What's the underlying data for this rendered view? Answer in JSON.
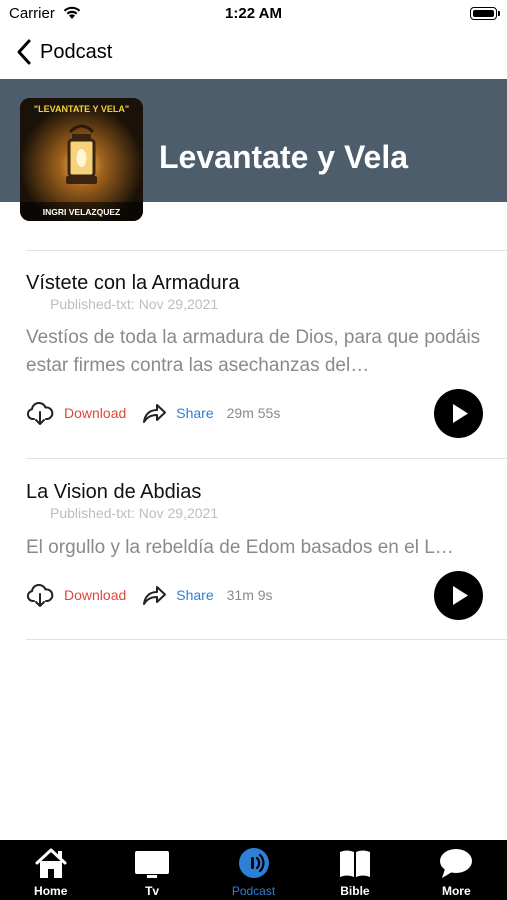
{
  "status_bar": {
    "carrier": "Carrier",
    "time": "1:22 AM",
    "icons": [
      "wifi-icon",
      "battery-icon"
    ]
  },
  "nav": {
    "back_label": "Podcast",
    "back_icon": "chevron-left-icon"
  },
  "podcast": {
    "title": "Levantate y Vela",
    "cover": {
      "title_text": "\"LEVANTATE Y VELA\"",
      "author_text": "INGRI VELAZQUEZ"
    },
    "header_color": "#4d5d6b"
  },
  "episodes": [
    {
      "title": "Vístete con la Armadura",
      "published": "Published-txt: Nov 29,2021",
      "description": "Vestíos de toda la armadura de Dios, para que podáis estar firmes contra las asechanzas del…",
      "download_label": "Download",
      "share_label": "Share",
      "duration": "29m 55s"
    },
    {
      "title": "La Vision de Abdias",
      "published": "Published-txt: Nov 29,2021",
      "description": "El orgullo y la rebeldía de Edom basados en el L…",
      "download_label": "Download",
      "share_label": "Share",
      "duration": "31m 9s"
    }
  ],
  "tab_bar": {
    "active_color": "#2e7fd6",
    "tabs": [
      {
        "label": "Home",
        "icon": "home-icon",
        "active": false
      },
      {
        "label": "Tv",
        "icon": "tv-icon",
        "active": false
      },
      {
        "label": "Podcast",
        "icon": "podcast-icon",
        "active": true
      },
      {
        "label": "Bible",
        "icon": "book-icon",
        "active": false
      },
      {
        "label": "More",
        "icon": "chat-bubble-icon",
        "active": false
      }
    ]
  }
}
